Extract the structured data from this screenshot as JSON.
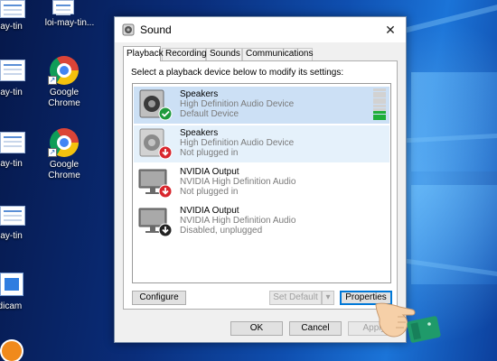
{
  "desktop": {
    "icons": [
      {
        "label": "loi-may-tin..."
      },
      {
        "label": "Google Chrome"
      },
      {
        "label": "Google Chrome"
      }
    ],
    "cut_labels": [
      {
        "label": "may-tin"
      },
      {
        "label": "may-tin"
      },
      {
        "label": "may-tin"
      },
      {
        "label": "may-tin"
      },
      {
        "label": "ndicam"
      }
    ]
  },
  "dialog": {
    "title": "Sound",
    "close_glyph": "✕",
    "tabs": [
      "Playback",
      "Recording",
      "Sounds",
      "Communications"
    ],
    "active_tab": "Playback",
    "instruction": "Select a playback device below to modify its settings:",
    "devices": [
      {
        "name": "Speakers",
        "description": "High Definition Audio Device",
        "status": "Default Device",
        "icon": "speaker-icon",
        "badge": "green-check-badge",
        "state": "selected"
      },
      {
        "name": "Speakers",
        "description": "High Definition Audio Device",
        "status": "Not plugged in",
        "icon": "speaker-icon",
        "badge": "red-down-arrow-badge",
        "state": "hovered"
      },
      {
        "name": "NVIDIA Output",
        "description": "NVIDIA High Definition Audio",
        "status": "Not plugged in",
        "icon": "monitor-icon",
        "badge": "red-down-arrow-badge",
        "state": "normal"
      },
      {
        "name": "NVIDIA Output",
        "description": "NVIDIA High Definition Audio",
        "status": "Disabled, unplugged",
        "icon": "monitor-icon",
        "badge": "black-down-arrow-badge",
        "state": "normal"
      }
    ],
    "level_meter": {
      "segments": 10,
      "lit": 3
    },
    "buttons": {
      "configure": "Configure",
      "set_default": "Set Default",
      "set_default_arrow": "▾",
      "properties": "Properties",
      "ok": "OK",
      "cancel": "Cancel",
      "apply": "Apply"
    }
  },
  "colors": {
    "selected_row": "#cce0f5",
    "hover_row": "#e5f1fb",
    "focus_border": "#0078d7",
    "level_on": "#1fae3a"
  }
}
